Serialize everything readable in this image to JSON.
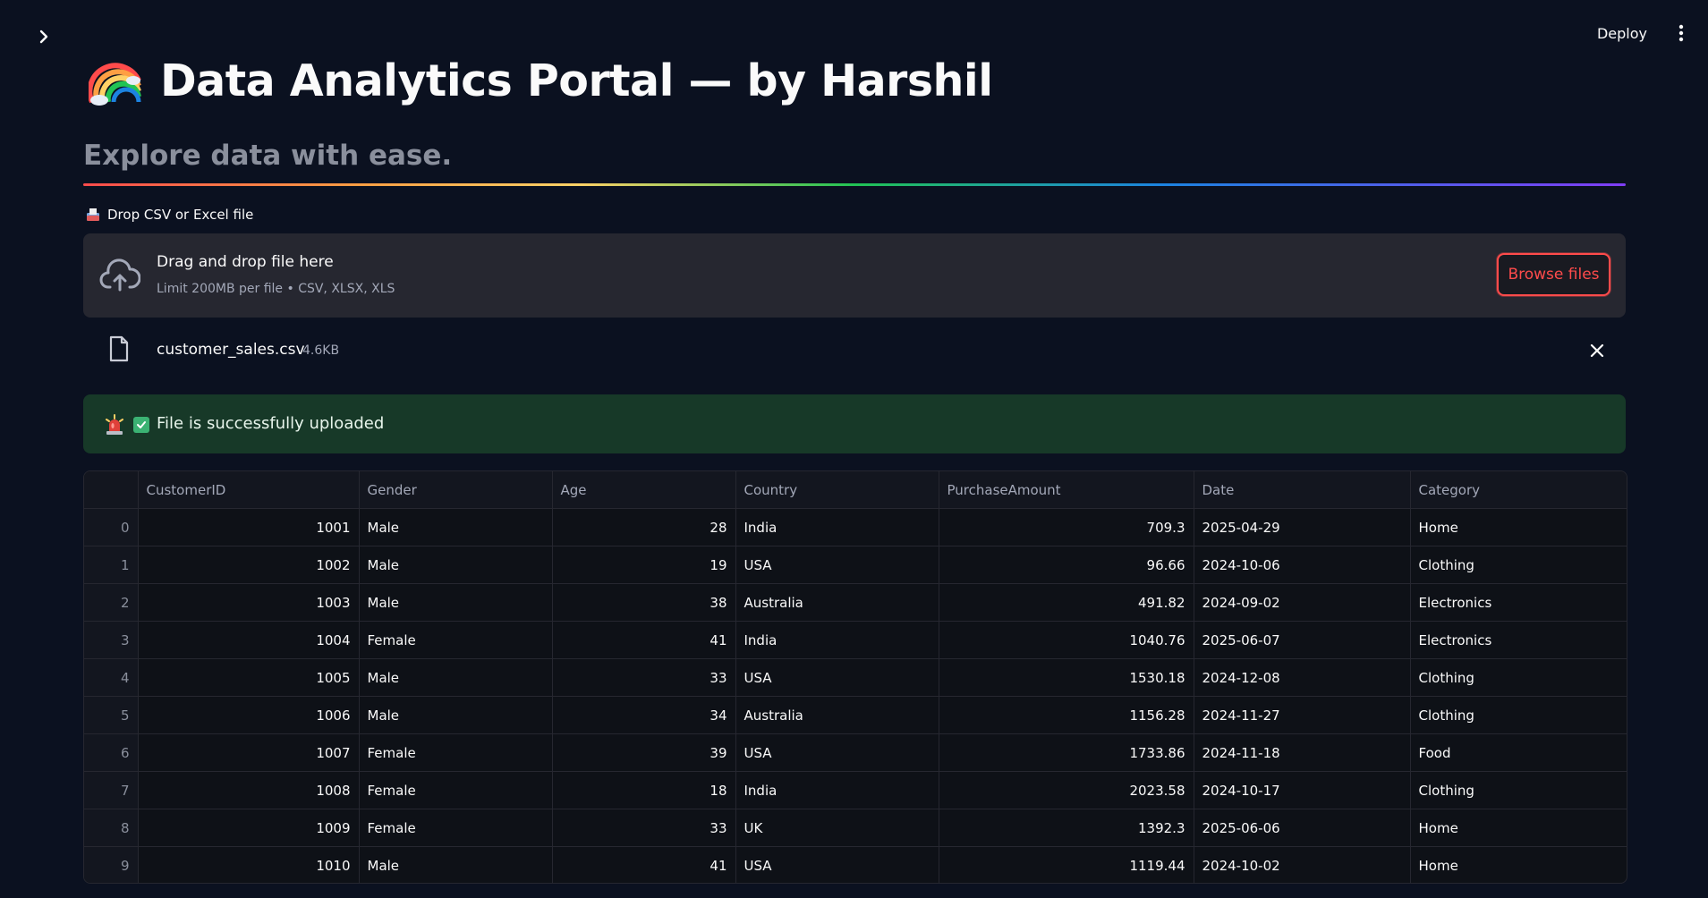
{
  "header": {
    "deploy_label": "Deploy"
  },
  "page": {
    "title": "Data Analytics Portal — by Harshil",
    "subtitle": "Explore data with ease."
  },
  "uploader": {
    "label": "Drop CSV or Excel file",
    "drop_title": "Drag and drop file here",
    "drop_limit": "Limit 200MB per file • CSV, XLSX, XLS",
    "browse_label": "Browse files"
  },
  "uploaded_file": {
    "name": "customer_sales.csv",
    "size": "4.6KB"
  },
  "alert": {
    "text": "File is successfully uploaded"
  },
  "table": {
    "columns": [
      "",
      "CustomerID",
      "Gender",
      "Age",
      "Country",
      "PurchaseAmount",
      "Date",
      "Category"
    ],
    "rows": [
      [
        "0",
        "1001",
        "Male",
        "28",
        "India",
        "709.3",
        "2025-04-29",
        "Home"
      ],
      [
        "1",
        "1002",
        "Male",
        "19",
        "USA",
        "96.66",
        "2024-10-06",
        "Clothing"
      ],
      [
        "2",
        "1003",
        "Male",
        "38",
        "Australia",
        "491.82",
        "2024-09-02",
        "Electronics"
      ],
      [
        "3",
        "1004",
        "Female",
        "41",
        "India",
        "1040.76",
        "2025-06-07",
        "Electronics"
      ],
      [
        "4",
        "1005",
        "Male",
        "33",
        "USA",
        "1530.18",
        "2024-12-08",
        "Clothing"
      ],
      [
        "5",
        "1006",
        "Male",
        "34",
        "Australia",
        "1156.28",
        "2024-11-27",
        "Clothing"
      ],
      [
        "6",
        "1007",
        "Female",
        "39",
        "USA",
        "1733.86",
        "2024-11-18",
        "Food"
      ],
      [
        "7",
        "1008",
        "Female",
        "18",
        "India",
        "2023.58",
        "2024-10-17",
        "Clothing"
      ],
      [
        "8",
        "1009",
        "Female",
        "33",
        "UK",
        "1392.3",
        "2025-06-06",
        "Home"
      ],
      [
        "9",
        "1010",
        "Male",
        "41",
        "USA",
        "1119.44",
        "2024-10-02",
        "Home"
      ]
    ]
  },
  "icons": {
    "expand": "chevron-right-icon",
    "menu": "more-vertical-icon",
    "title_emoji": "rainbow-icon",
    "uploader_label": "inbox-tray-icon",
    "dropzone": "cloud-upload-icon",
    "file": "file-icon",
    "remove": "close-icon",
    "siren": "siren-icon",
    "check": "check-box-icon"
  },
  "colors": {
    "background": "#0b1120",
    "accent": "#ff4b4b",
    "success_bg": "#173928",
    "success_check": "#3bb273",
    "dropzone_bg": "#262730"
  }
}
